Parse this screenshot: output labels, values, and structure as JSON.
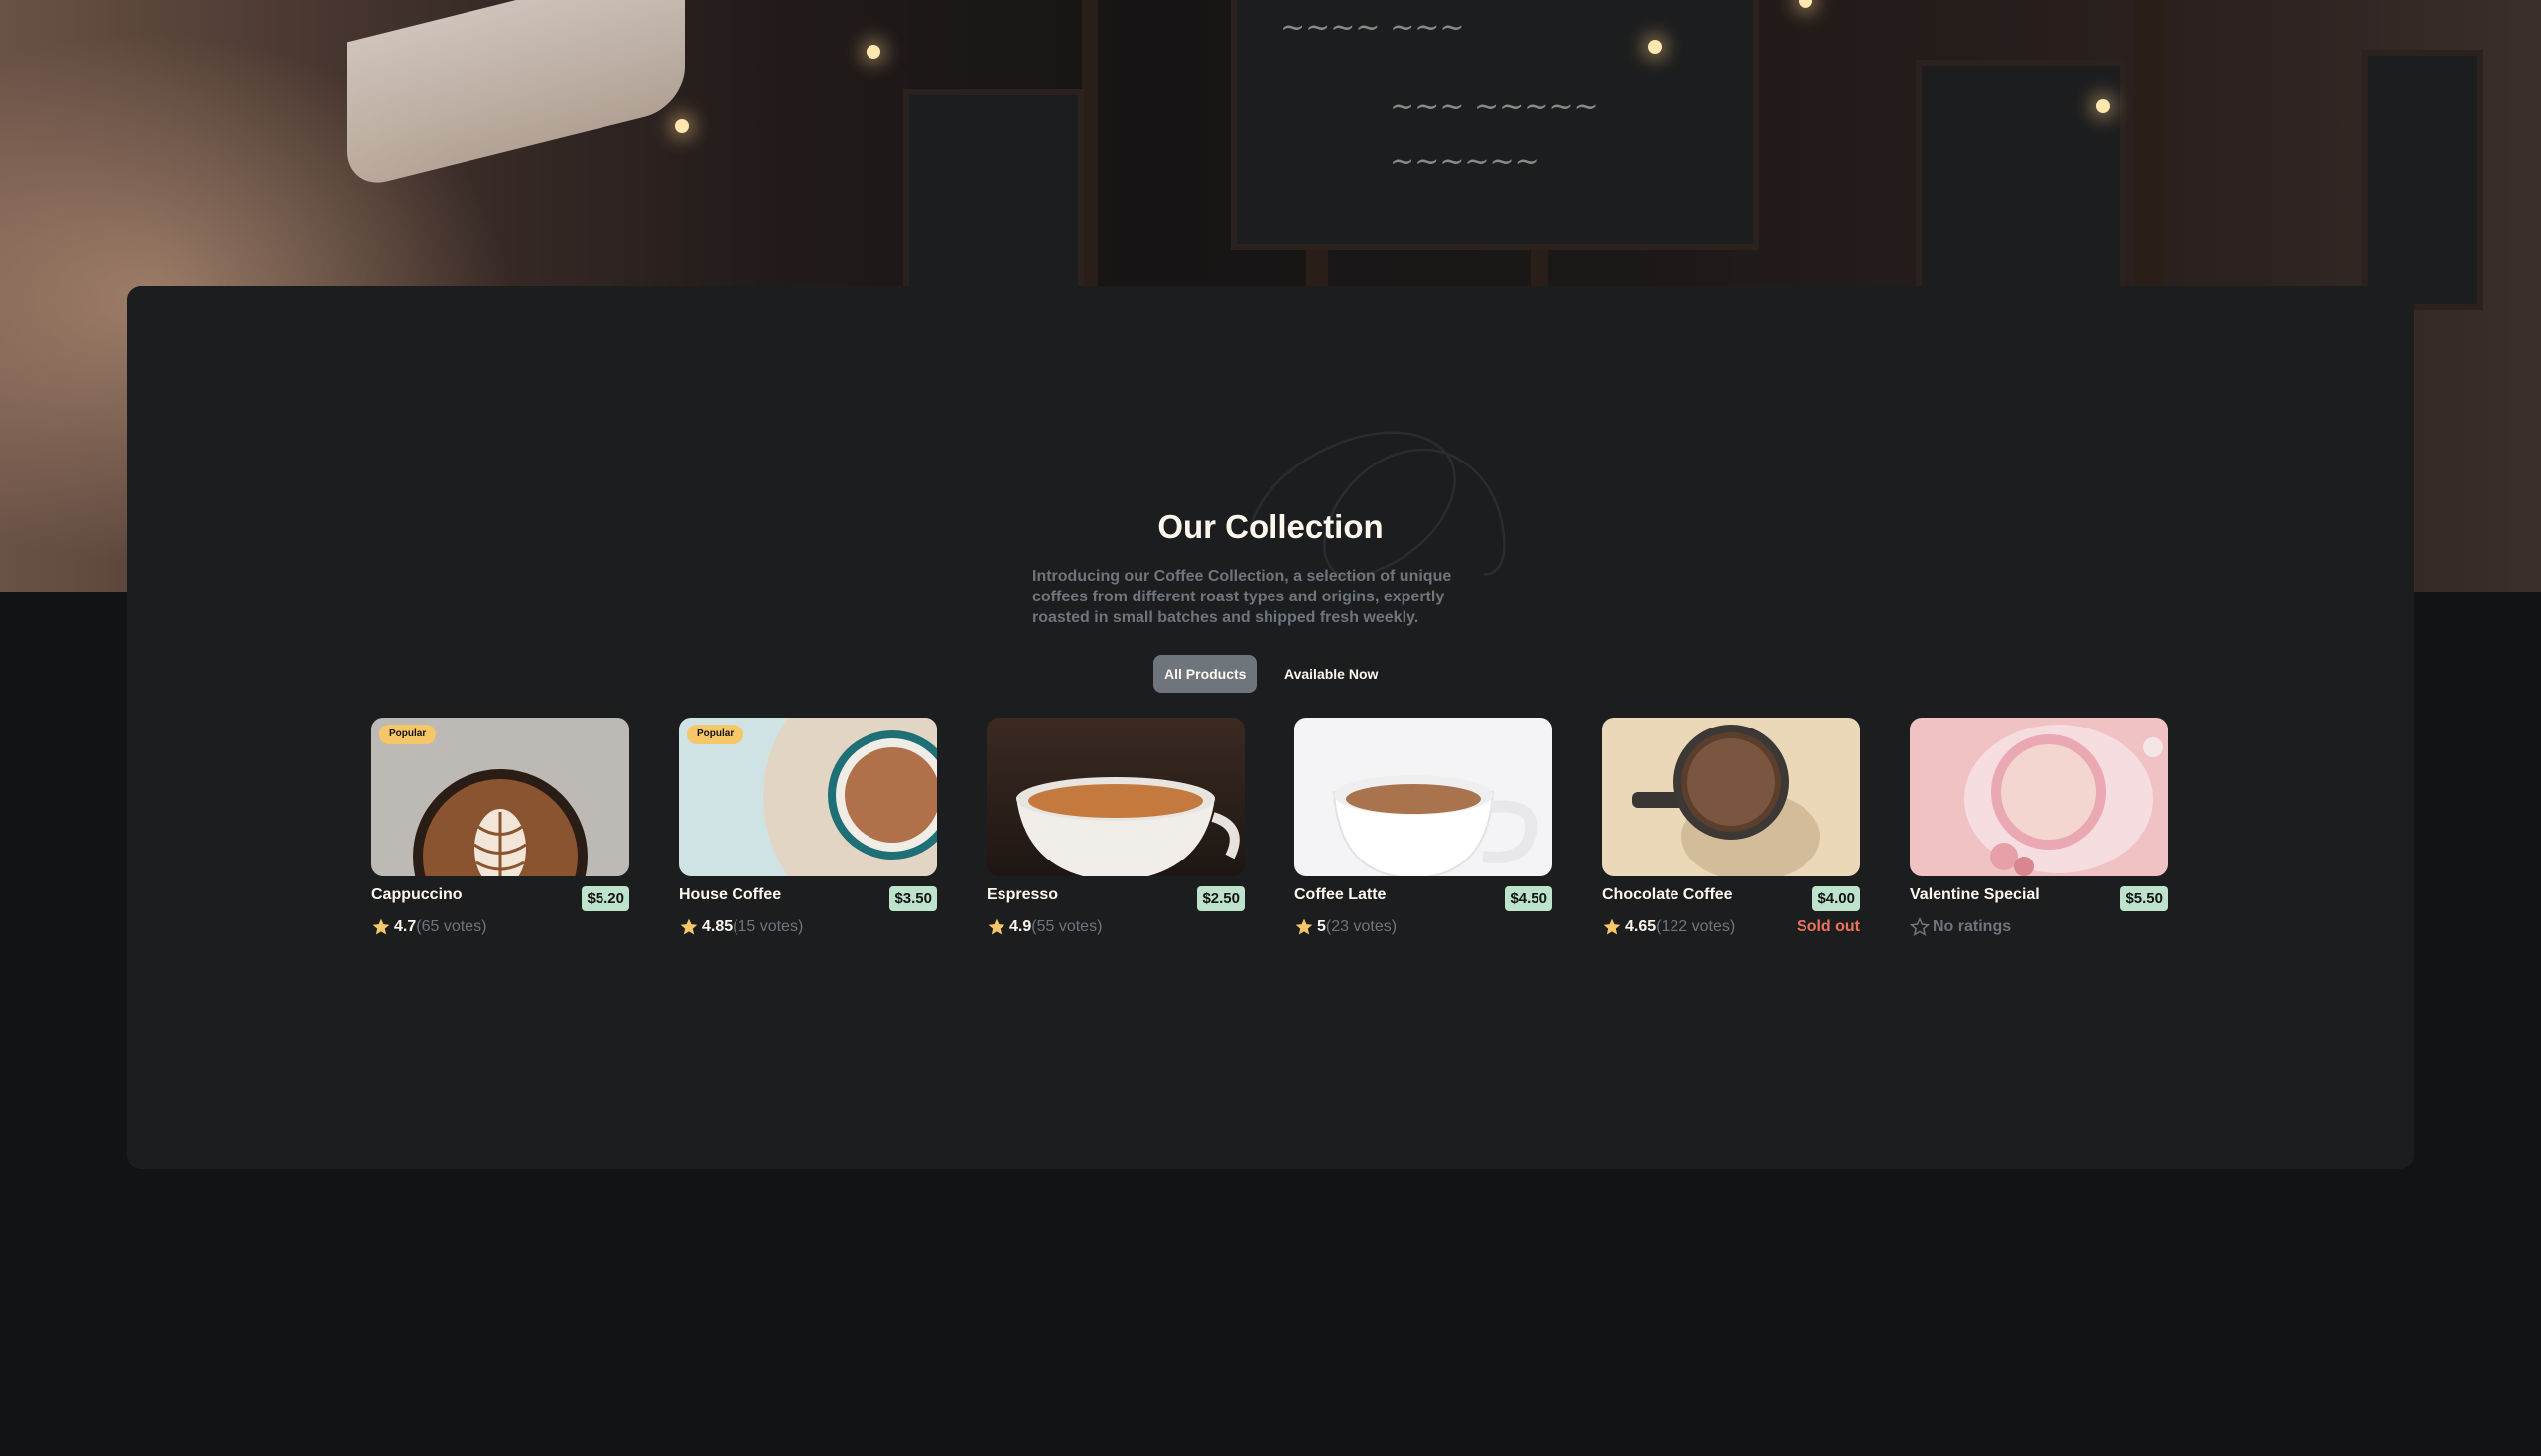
{
  "collection": {
    "title": "Our Collection",
    "description": "Introducing our Coffee Collection, a selection of unique coffees from different roast types and origins, expertly roasted in small batches and shipped fresh weekly."
  },
  "filters": {
    "all_label": "All Products",
    "available_label": "Available Now",
    "active": "all"
  },
  "colors": {
    "background": "#111315",
    "panel": "#1B1D1F",
    "text": "#FEF7EE",
    "muted": "#6F757C",
    "popular_badge": "#F6C768",
    "price_tag": "#BEE3CC",
    "sold_out": "#ED735D",
    "star": "#F6C768"
  },
  "products": [
    {
      "name": "Cappuccino",
      "price": "$5.20",
      "badge": "Popular",
      "rating": "4.7",
      "votes": "(65 votes)",
      "status": "",
      "icon": "cappuccino-latte-art-image"
    },
    {
      "name": "House Coffee",
      "price": "$3.50",
      "badge": "Popular",
      "rating": "4.85",
      "votes": "(15 votes)",
      "status": "",
      "icon": "house-coffee-cup-image"
    },
    {
      "name": "Espresso",
      "price": "$2.50",
      "badge": "",
      "rating": "4.9",
      "votes": "(55 votes)",
      "status": "",
      "icon": "espresso-cup-image"
    },
    {
      "name": "Coffee Latte",
      "price": "$4.50",
      "badge": "",
      "rating": "5",
      "votes": "(23 votes)",
      "status": "",
      "icon": "latte-cup-image"
    },
    {
      "name": "Chocolate Coffee",
      "price": "$4.00",
      "badge": "",
      "rating": "4.65",
      "votes": "(122 votes)",
      "status": "Sold out",
      "icon": "chocolate-coffee-mug-image"
    },
    {
      "name": "Valentine Special",
      "price": "$5.50",
      "badge": "",
      "rating": "",
      "votes": "",
      "no_rating_text": "No ratings",
      "status": "",
      "icon": "valentine-pink-latte-image"
    }
  ]
}
